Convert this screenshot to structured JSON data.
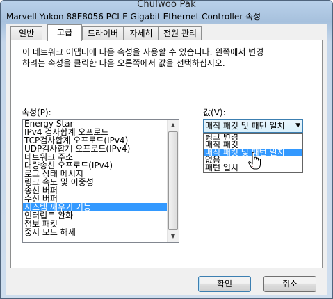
{
  "watermark": "Chulwoo Pak",
  "window": {
    "title": "Marvell Yukon 88E8056 PCI-E Gigabit Ethernet Controller 속성"
  },
  "tabs": [
    "일반",
    "고급",
    "드라이버",
    "자세히",
    "전원 관리"
  ],
  "active_tab": "고급",
  "description": "이 네트워크 어댑터에 다음 속성을 사용할 수 있습니다. 왼쪽에서 변경\n하려는 속성을 클릭한 다음 오른쪽에서 값을 선택하십시오.",
  "properties_label": "속성(P):",
  "value_label": "값(V):",
  "properties": [
    "Energy Star",
    "IPv4 검사합계 오프로드",
    "TCP검사합계 오프로드(IPv4)",
    "UDP검사합계 오프로드(IPv4)",
    "네트워크 주소",
    "대량송신 오프로드(IPv4)",
    "로그 상태 메시지",
    "링크 속도 및 이중성",
    "송신 버퍼",
    "수신 버퍼",
    "시스템 깨우기 기능",
    "인터럽트 완화",
    "점보 패킷",
    "중지 모드 해제"
  ],
  "selected_property": "시스템 깨우기 기능",
  "value_combo": {
    "selected": "매직 패킷 및 패턴 일치"
  },
  "value_options": [
    "링크 변경",
    "매직 패킷",
    "매직 패킷 및 패턴 일치",
    "없음",
    "패턴 일치"
  ],
  "highlighted_option": "매직 패킷 및 패턴 일치",
  "buttons": {
    "ok": "확인",
    "cancel": "취소"
  },
  "icons": {
    "combo_arrow": "chevron-down-icon",
    "cursor": "hand-pointer-icon",
    "scroll_up": "arrow-up-icon",
    "scroll_down": "arrow-down-icon"
  },
  "colors": {
    "selection": "#3399ff",
    "title_bar": "#b9d1ea"
  }
}
